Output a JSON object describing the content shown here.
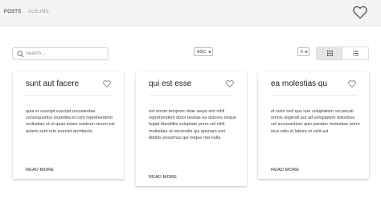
{
  "nav": {
    "tabs": [
      {
        "label": "POSTS"
      },
      {
        "label": "ALBUMS"
      }
    ]
  },
  "toolbar": {
    "search_placeholder": "Search...",
    "sort_value": "ASC",
    "per_page_value": "6"
  },
  "cards": [
    {
      "title": "sunt aut facere",
      "body": "quia et suscipit suscipit recusandae consequuntur expedita et cum reprehenderit molestiae ut ut quas totam nostrum rerum est autem sunt rem eveniet architecto",
      "read_more": "READ MORE"
    },
    {
      "title": "qui est esse",
      "body": "est rerum tempore vitae sequi sint nihil reprehenderit dolor beatae ea dolores neque fugiat blanditiis voluptate porro vel nihil molestiae ut reiciendis qui aperiam non debitis possimus qui neque nisi nulla",
      "read_more": "READ MORE"
    },
    {
      "title": "ea molestias qu",
      "body": "et iusto sed quo iure voluptatem occaecati omnis eligendi aut ad voluptatem doloribus vel accusantium quis pariatur molestiae porro eius odio et labore et velit aut",
      "read_more": "READ MORE"
    }
  ]
}
